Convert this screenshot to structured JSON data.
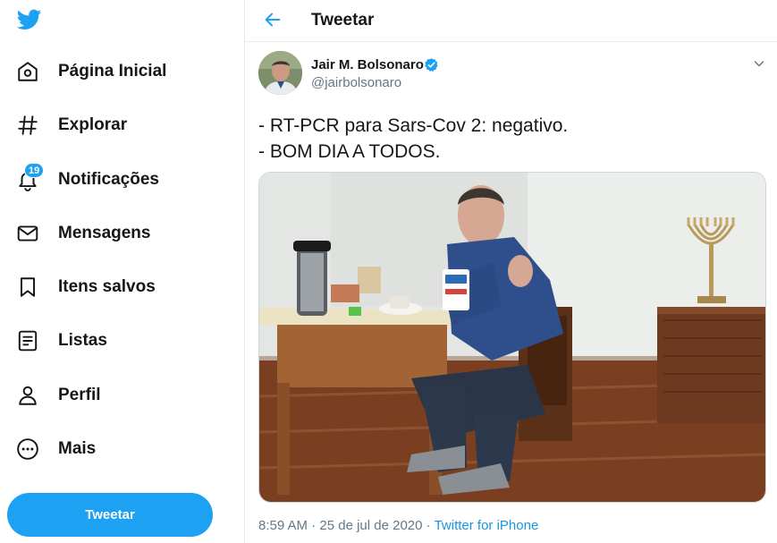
{
  "colors": {
    "accent": "#1da1f2",
    "text": "#14171a",
    "muted": "#657786",
    "link": "#1b95e0"
  },
  "sidebar": {
    "logo_icon": "twitter-bird-icon",
    "items": [
      {
        "label": "Página Inicial",
        "icon": "home-icon"
      },
      {
        "label": "Explorar",
        "icon": "hashtag-icon"
      },
      {
        "label": "Notificações",
        "icon": "bell-icon",
        "badge": "19"
      },
      {
        "label": "Mensagens",
        "icon": "envelope-icon"
      },
      {
        "label": "Itens salvos",
        "icon": "bookmark-icon"
      },
      {
        "label": "Listas",
        "icon": "list-icon"
      },
      {
        "label": "Perfil",
        "icon": "person-icon"
      },
      {
        "label": "Mais",
        "icon": "more-circle-icon"
      }
    ],
    "tweet_button": "Tweetar"
  },
  "header": {
    "title": "Tweetar",
    "back_icon": "arrow-left-icon"
  },
  "tweet": {
    "author_name": "Jair M. Bolsonaro",
    "handle": "@jairbolsonaro",
    "verified_icon": "verified-badge-icon",
    "text": "- RT-PCR para Sars-Cov 2: negativo.\n- BOM DIA A TODOS.",
    "time": "8:59 AM",
    "date": "25 de jul de 2020",
    "separator": "·",
    "source": "Twitter for iPhone"
  }
}
